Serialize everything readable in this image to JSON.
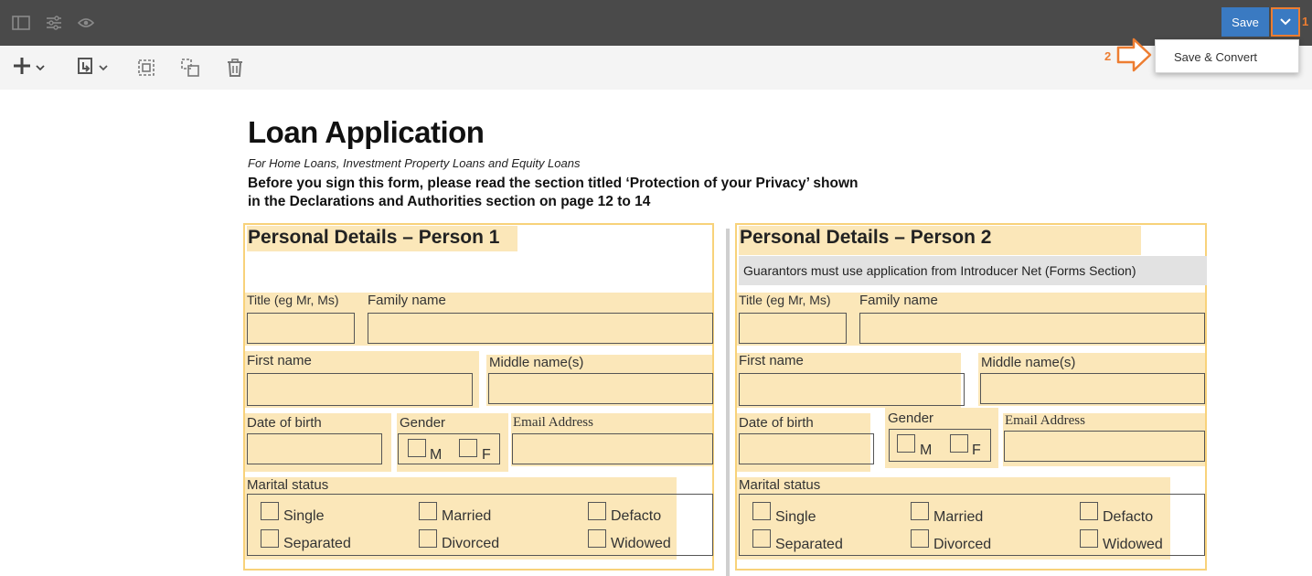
{
  "topbar": {
    "left_icons": [
      "sidebar-icon",
      "sliders-icon",
      "eye-icon"
    ],
    "save_label": "Save",
    "dropdown_icon": "chevron-down-icon",
    "callout_1": "1",
    "callout_2": "2",
    "accent": "#3a7ac2",
    "callout_color": "#ed7d31"
  },
  "dropdown_menu": {
    "items": [
      {
        "label": "Save & Convert"
      }
    ]
  },
  "toolbar": {
    "icons": [
      "add-icon",
      "insert-icon",
      "select-field-icon",
      "group-fields-icon",
      "delete-icon"
    ]
  },
  "doc": {
    "title": "Loan Application",
    "subtitle": "For Home Loans, Investment Property Loans and Equity Loans",
    "warning_line1": "Before you sign this form, please read the section titled ‘Protection of your Privacy’ shown",
    "warning_line2": "in the Declarations and Authorities section on page 12 to 14",
    "highlight_color": "#fbe7b9",
    "person1": {
      "heading": "Personal Details – Person 1",
      "title_label": "Title (eg Mr, Ms)",
      "family_label": "Family name",
      "first_label": "First name",
      "middle_label": "Middle name(s)",
      "dob_label": "Date of birth",
      "gender_label": "Gender",
      "email_label": "Email Address",
      "gender_m": "M",
      "gender_f": "F",
      "marital_label": "Marital status",
      "single": "Single",
      "married": "Married",
      "defacto": "Defacto",
      "separated": "Separated",
      "divorced": "Divorced",
      "widowed": "Widowed"
    },
    "person2": {
      "heading": "Personal Details – Person 2",
      "note": "Guarantors must use application from Introducer Net (Forms Section)",
      "title_label": "Title (eg Mr, Ms)",
      "family_label": "Family name",
      "first_label": "First name",
      "middle_label": "Middle name(s)",
      "dob_label": "Date of birth",
      "gender_label": "Gender",
      "email_label": "Email Address",
      "gender_m": "M",
      "gender_f": "F",
      "marital_label": "Marital status",
      "single": "Single",
      "married": "Married",
      "defacto": "Defacto",
      "separated": "Separated",
      "divorced": "Divorced",
      "widowed": "Widowed"
    }
  }
}
